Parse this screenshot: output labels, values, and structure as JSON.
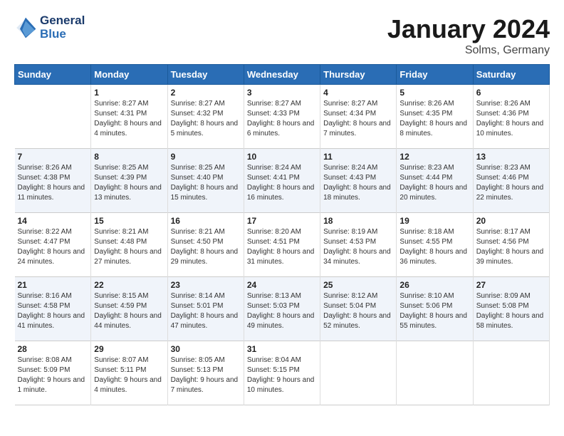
{
  "header": {
    "logo_line1": "General",
    "logo_line2": "Blue",
    "month": "January 2024",
    "location": "Solms, Germany"
  },
  "weekdays": [
    "Sunday",
    "Monday",
    "Tuesday",
    "Wednesday",
    "Thursday",
    "Friday",
    "Saturday"
  ],
  "weeks": [
    [
      {
        "day": "",
        "sunrise": "",
        "sunset": "",
        "daylight": ""
      },
      {
        "day": "1",
        "sunrise": "Sunrise: 8:27 AM",
        "sunset": "Sunset: 4:31 PM",
        "daylight": "Daylight: 8 hours and 4 minutes."
      },
      {
        "day": "2",
        "sunrise": "Sunrise: 8:27 AM",
        "sunset": "Sunset: 4:32 PM",
        "daylight": "Daylight: 8 hours and 5 minutes."
      },
      {
        "day": "3",
        "sunrise": "Sunrise: 8:27 AM",
        "sunset": "Sunset: 4:33 PM",
        "daylight": "Daylight: 8 hours and 6 minutes."
      },
      {
        "day": "4",
        "sunrise": "Sunrise: 8:27 AM",
        "sunset": "Sunset: 4:34 PM",
        "daylight": "Daylight: 8 hours and 7 minutes."
      },
      {
        "day": "5",
        "sunrise": "Sunrise: 8:26 AM",
        "sunset": "Sunset: 4:35 PM",
        "daylight": "Daylight: 8 hours and 8 minutes."
      },
      {
        "day": "6",
        "sunrise": "Sunrise: 8:26 AM",
        "sunset": "Sunset: 4:36 PM",
        "daylight": "Daylight: 8 hours and 10 minutes."
      }
    ],
    [
      {
        "day": "7",
        "sunrise": "Sunrise: 8:26 AM",
        "sunset": "Sunset: 4:38 PM",
        "daylight": "Daylight: 8 hours and 11 minutes."
      },
      {
        "day": "8",
        "sunrise": "Sunrise: 8:25 AM",
        "sunset": "Sunset: 4:39 PM",
        "daylight": "Daylight: 8 hours and 13 minutes."
      },
      {
        "day": "9",
        "sunrise": "Sunrise: 8:25 AM",
        "sunset": "Sunset: 4:40 PM",
        "daylight": "Daylight: 8 hours and 15 minutes."
      },
      {
        "day": "10",
        "sunrise": "Sunrise: 8:24 AM",
        "sunset": "Sunset: 4:41 PM",
        "daylight": "Daylight: 8 hours and 16 minutes."
      },
      {
        "day": "11",
        "sunrise": "Sunrise: 8:24 AM",
        "sunset": "Sunset: 4:43 PM",
        "daylight": "Daylight: 8 hours and 18 minutes."
      },
      {
        "day": "12",
        "sunrise": "Sunrise: 8:23 AM",
        "sunset": "Sunset: 4:44 PM",
        "daylight": "Daylight: 8 hours and 20 minutes."
      },
      {
        "day": "13",
        "sunrise": "Sunrise: 8:23 AM",
        "sunset": "Sunset: 4:46 PM",
        "daylight": "Daylight: 8 hours and 22 minutes."
      }
    ],
    [
      {
        "day": "14",
        "sunrise": "Sunrise: 8:22 AM",
        "sunset": "Sunset: 4:47 PM",
        "daylight": "Daylight: 8 hours and 24 minutes."
      },
      {
        "day": "15",
        "sunrise": "Sunrise: 8:21 AM",
        "sunset": "Sunset: 4:48 PM",
        "daylight": "Daylight: 8 hours and 27 minutes."
      },
      {
        "day": "16",
        "sunrise": "Sunrise: 8:21 AM",
        "sunset": "Sunset: 4:50 PM",
        "daylight": "Daylight: 8 hours and 29 minutes."
      },
      {
        "day": "17",
        "sunrise": "Sunrise: 8:20 AM",
        "sunset": "Sunset: 4:51 PM",
        "daylight": "Daylight: 8 hours and 31 minutes."
      },
      {
        "day": "18",
        "sunrise": "Sunrise: 8:19 AM",
        "sunset": "Sunset: 4:53 PM",
        "daylight": "Daylight: 8 hours and 34 minutes."
      },
      {
        "day": "19",
        "sunrise": "Sunrise: 8:18 AM",
        "sunset": "Sunset: 4:55 PM",
        "daylight": "Daylight: 8 hours and 36 minutes."
      },
      {
        "day": "20",
        "sunrise": "Sunrise: 8:17 AM",
        "sunset": "Sunset: 4:56 PM",
        "daylight": "Daylight: 8 hours and 39 minutes."
      }
    ],
    [
      {
        "day": "21",
        "sunrise": "Sunrise: 8:16 AM",
        "sunset": "Sunset: 4:58 PM",
        "daylight": "Daylight: 8 hours and 41 minutes."
      },
      {
        "day": "22",
        "sunrise": "Sunrise: 8:15 AM",
        "sunset": "Sunset: 4:59 PM",
        "daylight": "Daylight: 8 hours and 44 minutes."
      },
      {
        "day": "23",
        "sunrise": "Sunrise: 8:14 AM",
        "sunset": "Sunset: 5:01 PM",
        "daylight": "Daylight: 8 hours and 47 minutes."
      },
      {
        "day": "24",
        "sunrise": "Sunrise: 8:13 AM",
        "sunset": "Sunset: 5:03 PM",
        "daylight": "Daylight: 8 hours and 49 minutes."
      },
      {
        "day": "25",
        "sunrise": "Sunrise: 8:12 AM",
        "sunset": "Sunset: 5:04 PM",
        "daylight": "Daylight: 8 hours and 52 minutes."
      },
      {
        "day": "26",
        "sunrise": "Sunrise: 8:10 AM",
        "sunset": "Sunset: 5:06 PM",
        "daylight": "Daylight: 8 hours and 55 minutes."
      },
      {
        "day": "27",
        "sunrise": "Sunrise: 8:09 AM",
        "sunset": "Sunset: 5:08 PM",
        "daylight": "Daylight: 8 hours and 58 minutes."
      }
    ],
    [
      {
        "day": "28",
        "sunrise": "Sunrise: 8:08 AM",
        "sunset": "Sunset: 5:09 PM",
        "daylight": "Daylight: 9 hours and 1 minute."
      },
      {
        "day": "29",
        "sunrise": "Sunrise: 8:07 AM",
        "sunset": "Sunset: 5:11 PM",
        "daylight": "Daylight: 9 hours and 4 minutes."
      },
      {
        "day": "30",
        "sunrise": "Sunrise: 8:05 AM",
        "sunset": "Sunset: 5:13 PM",
        "daylight": "Daylight: 9 hours and 7 minutes."
      },
      {
        "day": "31",
        "sunrise": "Sunrise: 8:04 AM",
        "sunset": "Sunset: 5:15 PM",
        "daylight": "Daylight: 9 hours and 10 minutes."
      },
      {
        "day": "",
        "sunrise": "",
        "sunset": "",
        "daylight": ""
      },
      {
        "day": "",
        "sunrise": "",
        "sunset": "",
        "daylight": ""
      },
      {
        "day": "",
        "sunrise": "",
        "sunset": "",
        "daylight": ""
      }
    ]
  ]
}
